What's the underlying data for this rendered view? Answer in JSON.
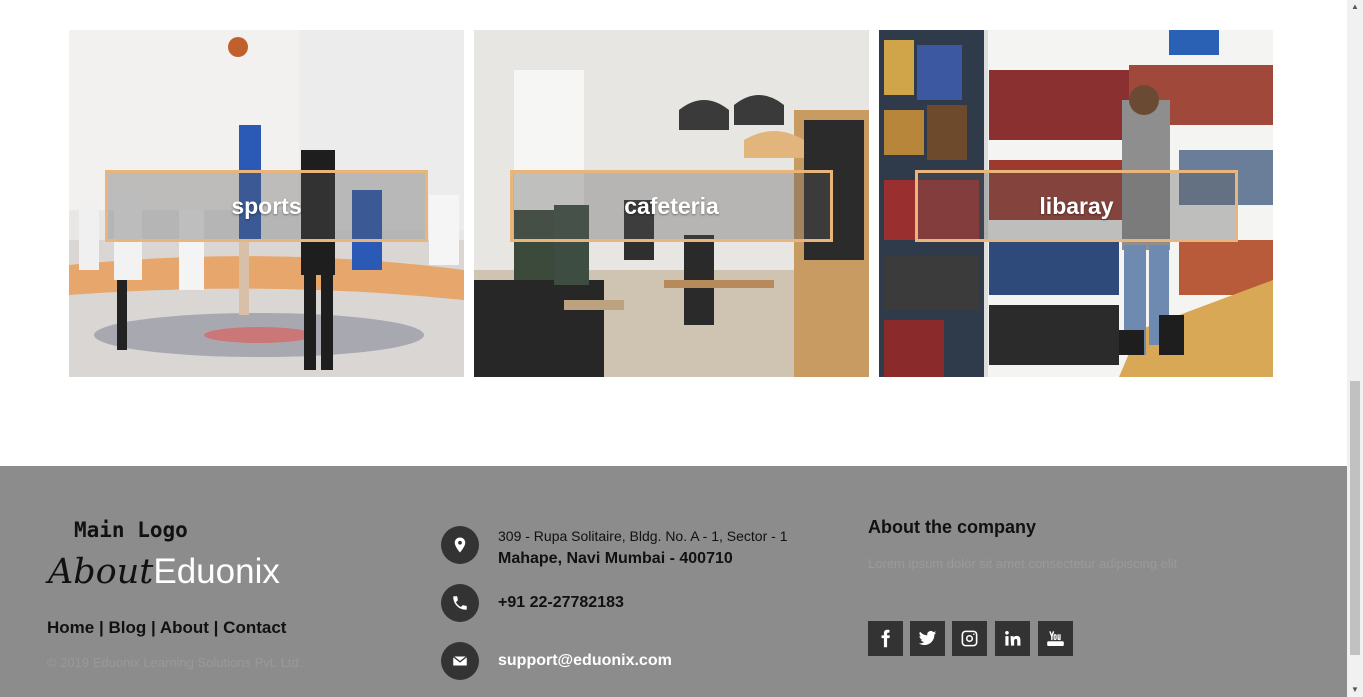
{
  "gallery": {
    "tiles": [
      {
        "label": "sports"
      },
      {
        "label": "cafeteria"
      },
      {
        "label": "libaray"
      }
    ],
    "accent_border": "#e8b57d"
  },
  "footer": {
    "main_logo": "Main Logo",
    "brand_part1": "About",
    "brand_part2": "Eduonix",
    "nav": [
      "Home",
      "Blog",
      "About",
      "Contact"
    ],
    "separator": "|",
    "copyright": "© 2019 Eduonix Learning Solutions Pvt. Ltd.",
    "address_line1": "309 - Rupa Solitaire, Bldg. No. A - 1, Sector - 1",
    "address_line2": "Mahape, Navi Mumbai - 400710",
    "phone": "+91 22-27782183",
    "email": "support@eduonix.com",
    "about_title": "About the company",
    "about_text": "Lorem ipsum dolor sit amet consectetur adipiscing elit",
    "social": [
      "facebook-icon",
      "twitter-icon",
      "instagram-icon",
      "linkedin-icon",
      "youtube-icon"
    ],
    "background": "#8c8c8c"
  }
}
